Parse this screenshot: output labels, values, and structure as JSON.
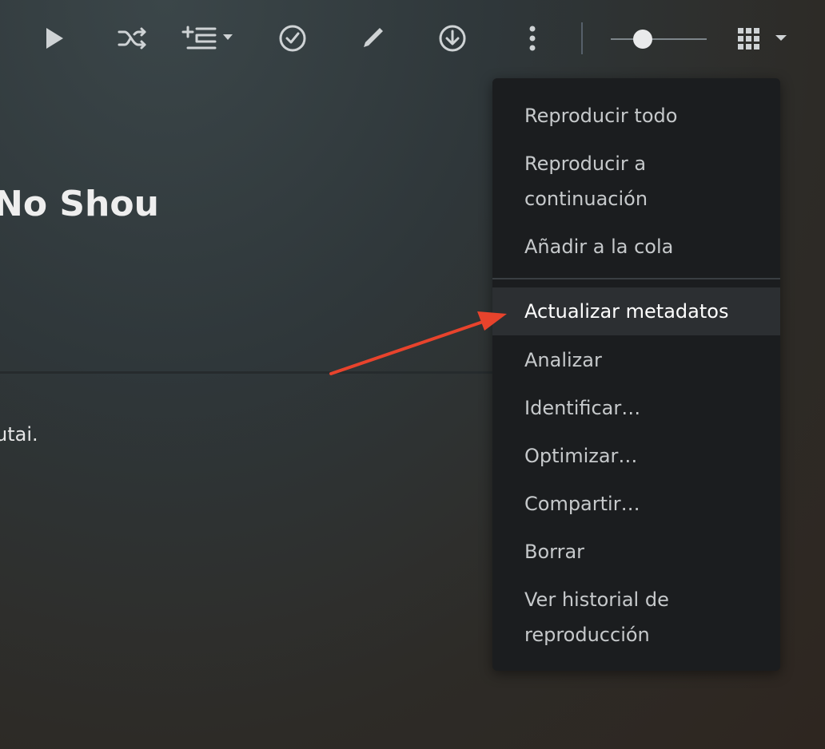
{
  "toolbar": {
    "icons": [
      "play-icon",
      "shuffle-icon",
      "add-to-playlist-icon",
      "check-circle-icon",
      "pencil-icon",
      "download-icon",
      "more-vertical-icon",
      "grid-view-icon"
    ]
  },
  "header": {
    "title": "No Shou"
  },
  "main": {
    "description": "utai."
  },
  "menu": {
    "items": [
      "Reproducir todo",
      "Reproducir a continuación",
      "Añadir a la cola",
      "Actualizar metadatos",
      "Analizar",
      "Identificar…",
      "Optimizar…",
      "Compartir…",
      "Borrar",
      "Ver historial de reproducción"
    ],
    "active_item": "Actualizar metadatos"
  },
  "annotation": {
    "arrow_color": "#e8432c"
  }
}
